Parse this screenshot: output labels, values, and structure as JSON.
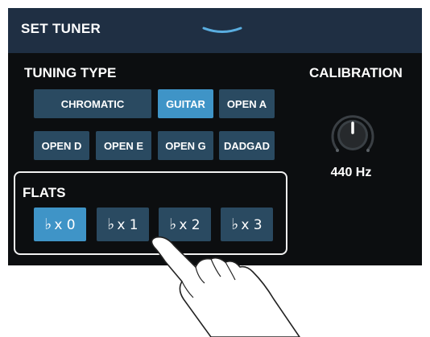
{
  "header": {
    "title": "SET TUNER",
    "collapse_icon": "chevron-down-icon"
  },
  "tuning_type": {
    "label": "TUNING TYPE",
    "options": [
      "CHROMATIC",
      "GUITAR",
      "OPEN A",
      "OPEN D",
      "OPEN E",
      "OPEN G",
      "DADGAD"
    ],
    "selected": "GUITAR"
  },
  "calibration": {
    "label": "CALIBRATION",
    "value": "440 Hz",
    "knob_icon": "knob-icon"
  },
  "flats": {
    "label": "FLATS",
    "symbol": "♭",
    "options": [
      "x 0",
      "x 1",
      "x 2",
      "x 3"
    ],
    "selected": "x 0"
  },
  "colors": {
    "header_bg": "#1f2f43",
    "button_bg": "#2a4a61",
    "active_bg": "#3f94c7",
    "screen_bg": "#0c0e10"
  }
}
